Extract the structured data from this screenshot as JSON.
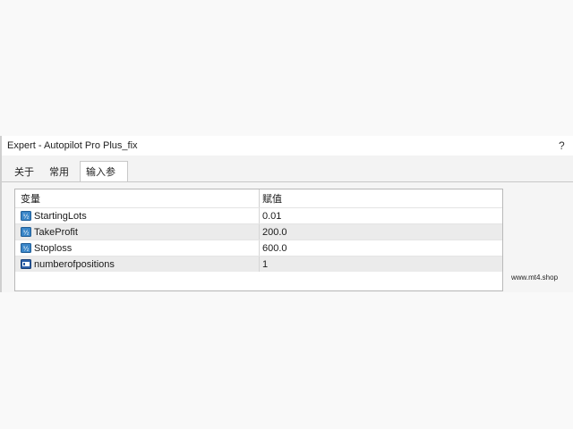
{
  "window": {
    "title": "Expert - Autopilot Pro Plus_fix",
    "help_label": "?"
  },
  "tabs": [
    {
      "label": "关于",
      "active": false
    },
    {
      "label": "常用",
      "active": false
    },
    {
      "label": "输入参数",
      "active": true
    }
  ],
  "grid": {
    "columns": [
      "变量",
      "赋值"
    ],
    "rows": [
      {
        "name": "StartingLots",
        "value": "0.01",
        "icon": "double-param-icon"
      },
      {
        "name": "TakeProfit",
        "value": "200.0",
        "icon": "double-param-icon"
      },
      {
        "name": "Stoploss",
        "value": "600.0",
        "icon": "double-param-icon"
      },
      {
        "name": "numberofpositions",
        "value": "1",
        "icon": "int-param-icon"
      }
    ]
  },
  "watermark": "www.mt4.shop",
  "colors": {
    "icon_double": "#3a86c8",
    "icon_int": "#2b5fa8",
    "row_alt": "#ebebeb"
  }
}
